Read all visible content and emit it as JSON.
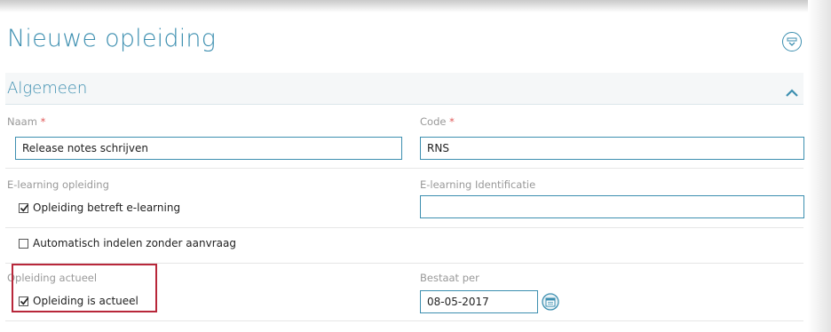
{
  "page": {
    "title": "Nieuwe opleiding"
  },
  "section": {
    "title": "Algemeen"
  },
  "fields": {
    "naam": {
      "label": "Naam",
      "required_mark": "*",
      "value": "Release notes schrijven"
    },
    "code": {
      "label": "Code",
      "required_mark": "*",
      "value": "RNS"
    },
    "elearning": {
      "label": "E-learning opleiding",
      "checkbox_label": "Opleiding betreft e-learning",
      "checked": true
    },
    "elearning_id": {
      "label": "E-learning Identificatie",
      "value": ""
    },
    "auto_indelen": {
      "checkbox_label": "Automatisch indelen zonder aanvraag",
      "checked": false
    },
    "actueel": {
      "label": "Opleiding actueel",
      "checkbox_label": "Opleiding is actueel",
      "checked": true
    },
    "bestaat_per": {
      "label": "Bestaat per",
      "value": "08-05-2017"
    }
  },
  "colors": {
    "accent": "#3d8fb0",
    "highlight_box": "#b8273a",
    "required": "#e05a5a"
  },
  "icons": {
    "header_action": "download-icon",
    "collapse": "chevron-up-icon",
    "date_picker": "calendar-icon"
  }
}
